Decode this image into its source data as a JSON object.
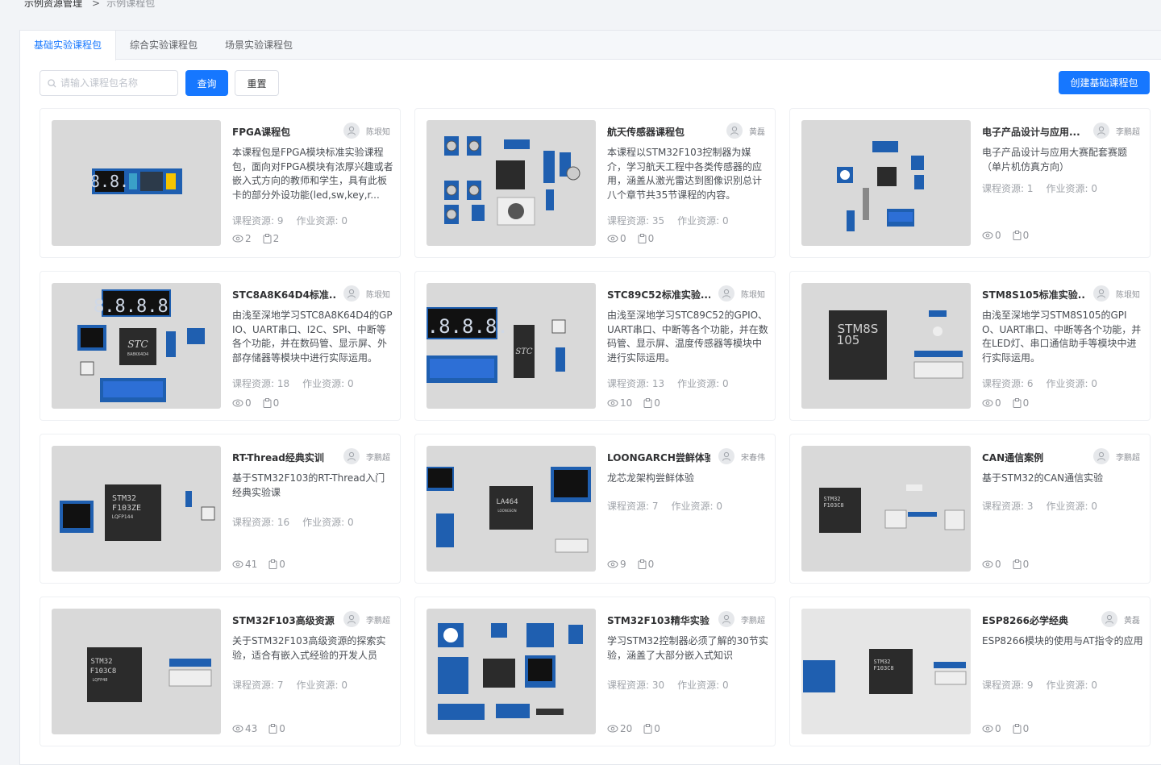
{
  "breadcrumb": {
    "parent": "示例资源管理",
    "separator": ">",
    "current": "示例课程包"
  },
  "tabs": [
    "基础实验课程包",
    "综合实验课程包",
    "场景实验课程包"
  ],
  "search": {
    "placeholder": "请输入课程包名称",
    "query_label": "查询",
    "reset_label": "重置"
  },
  "create_label": "创建基础课程包",
  "cards": [
    {
      "title": "FPGA课程包",
      "author": "陈垠知",
      "desc": "本课程包是FPGA模块标准实验课程包，面向对FPGA模块有浓厚兴趣或者嵌入式方向的教师和学生，具有此板卡的部分外设功能(led,sw,key,r...",
      "course": "课程资源: 9",
      "homework": "作业资源: 0",
      "views": "2",
      "favs": "2"
    },
    {
      "title": "航天传感器课程包",
      "author": "黄磊",
      "desc": "本课程以STM32F103控制器为媒介，学习航天工程中各类传感器的应用，涵盖从激光雷达到图像识别总计八个章节共35节课程的内容。",
      "course": "课程资源: 35",
      "homework": "作业资源: 0",
      "views": "0",
      "favs": "0"
    },
    {
      "title": "电子产品设计与应用...",
      "author": "李鹏超",
      "desc": "电子产品设计与应用大赛配套赛题（单片机仿真方向）",
      "course": "课程资源: 1",
      "homework": "作业资源: 0",
      "views": "0",
      "favs": "0"
    },
    {
      "title": "STC8A8K64D4标准...",
      "author": "陈垠知",
      "desc": "由浅至深地学习STC8A8K64D4的GPIO、UART串口、I2C、SPI、中断等各个功能，并在数码管、显示屏、外部存储器等模块中进行实际运用。",
      "course": "课程资源: 18",
      "homework": "作业资源: 0",
      "views": "0",
      "favs": "0"
    },
    {
      "title": "STC89C52标准实验...",
      "author": "陈垠知",
      "desc": "由浅至深地学习STC89C52的GPIO、UART串口、中断等各个功能，并在数码管、显示屏、温度传感器等模块中进行实际运用。",
      "course": "课程资源: 13",
      "homework": "作业资源: 0",
      "views": "10",
      "favs": "0"
    },
    {
      "title": "STM8S105标准实验...",
      "author": "陈垠知",
      "desc": "由浅至深地学习STM8S105的GPIO、UART串口、中断等各个功能，并在LED灯、串口通信助手等模块中进行实际运用。",
      "course": "课程资源: 6",
      "homework": "作业资源: 0",
      "views": "0",
      "favs": "0"
    },
    {
      "title": "RT-Thread经典实训",
      "author": "李鹏超",
      "desc": "基于STM32F103的RT-Thread入门经典实验课",
      "course": "课程资源: 16",
      "homework": "作业资源: 0",
      "views": "41",
      "favs": "0"
    },
    {
      "title": "LOONGARCH尝鲜体验",
      "author": "宋春伟",
      "desc": "龙芯龙架构尝鲜体验",
      "course": "课程资源: 7",
      "homework": "作业资源: 0",
      "views": "9",
      "favs": "0"
    },
    {
      "title": "CAN通信案例",
      "author": "李鹏超",
      "desc": "基于STM32的CAN通信实验",
      "course": "课程资源: 3",
      "homework": "作业资源: 0",
      "views": "0",
      "favs": "0"
    },
    {
      "title": "STM32F103高级资源...",
      "author": "李鹏超",
      "desc": "关于STM32F103高级资源的探索实验，适合有嵌入式经验的开发人员",
      "course": "课程资源: 7",
      "homework": "作业资源: 0",
      "views": "43",
      "favs": "0"
    },
    {
      "title": "STM32F103精华实验...",
      "author": "李鹏超",
      "desc": "学习STM32控制器必须了解的30节实验，涵盖了大部分嵌入式知识",
      "course": "课程资源: 30",
      "homework": "作业资源: 0",
      "views": "20",
      "favs": "0"
    },
    {
      "title": "ESP8266必学经典",
      "author": "黄磊",
      "desc": "ESP8266模块的使用与AT指令的应用",
      "course": "课程资源: 9",
      "homework": "作业资源: 0",
      "views": "0",
      "favs": "0"
    }
  ],
  "thumb_texts": {
    "seg_small": "8.8.",
    "seg4": "8.8.8.8.",
    "stc": "STC",
    "stc_sub": "8A8K64D4",
    "stm8_line1": "STM8S",
    "stm8_line2": "105",
    "stm32_line1": "STM32",
    "stm32_line2": "F103ZE",
    "stm32_line3": "LQFP144",
    "stm32c_line2": "F103C8",
    "stm32c_line3": "LQFP48",
    "la": "LA464",
    "la_sub": "LOONGSON",
    "stc_small": "STC"
  },
  "icons": {
    "avatar": "user-icon",
    "views": "eye-icon",
    "favs": "clipboard-icon",
    "search": "search-icon"
  },
  "colors": {
    "accent": "#1677ff",
    "thumb_bg": "#d9d9d9",
    "chip": "#2b2b2b",
    "blue_module": "#1f5fb0"
  }
}
